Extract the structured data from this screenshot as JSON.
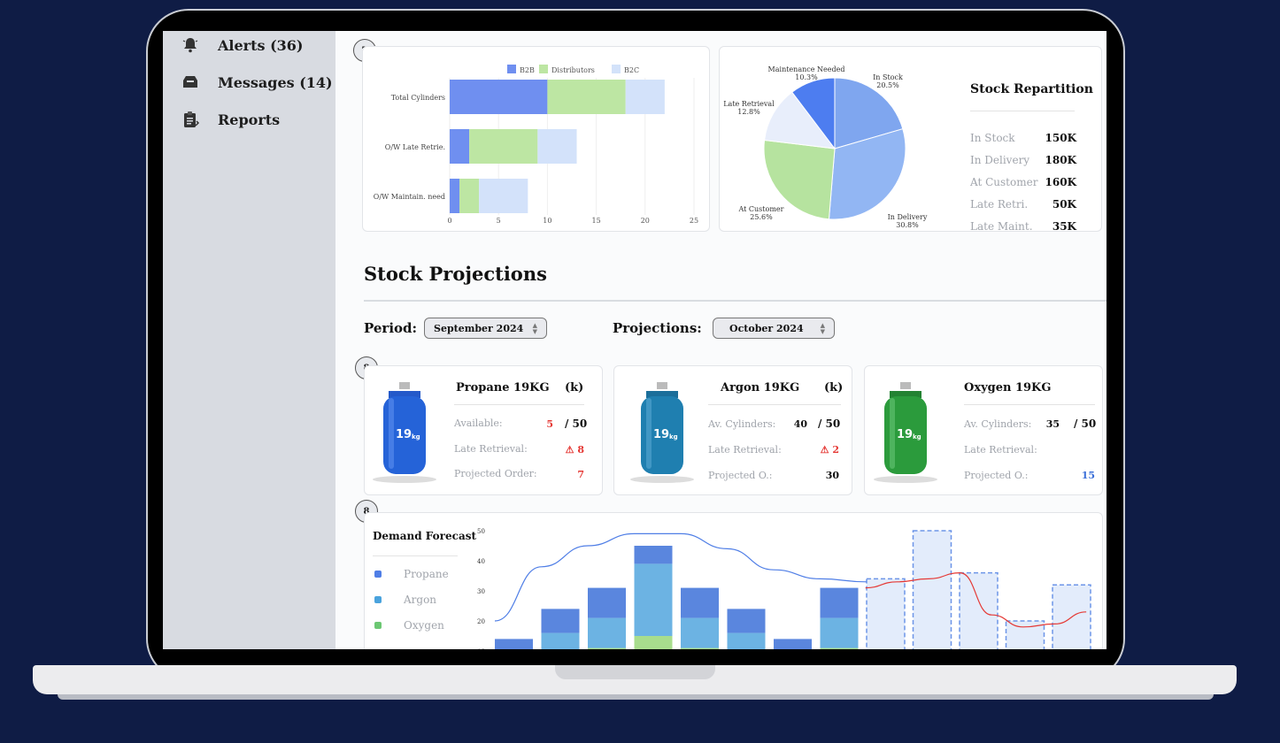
{
  "sidebar": {
    "items": [
      {
        "label": "Alerts (36)",
        "icon": "bell-icon"
      },
      {
        "label": "Messages (14)",
        "icon": "inbox-icon"
      },
      {
        "label": "Reports",
        "icon": "clipboard-icon"
      }
    ]
  },
  "steps": {
    "first": "7",
    "second": "8",
    "third": "8"
  },
  "stock_repartition": {
    "title": "Stock Repartition",
    "rows": [
      {
        "label": "In Stock",
        "value": "150K"
      },
      {
        "label": "In Delivery",
        "value": "180K"
      },
      {
        "label": "At Customer",
        "value": "160K"
      },
      {
        "label": "Late Retri.",
        "value": "50K"
      },
      {
        "label": "Late Maint.",
        "value": "35K"
      }
    ]
  },
  "projections": {
    "title": "Stock Projections",
    "period_label": "Period:",
    "period_value": "September 2024",
    "projections_label": "Projections:",
    "projections_value": "October 2024"
  },
  "products": [
    {
      "name": "Propane 19KG",
      "unit": "(k)",
      "color": "#2563d8",
      "tag": "19",
      "rows": [
        {
          "label": "Available:",
          "value": "5",
          "color": "red",
          "denom": "/ 50"
        },
        {
          "label": "Late Retrieval:",
          "value": "⚠ 8",
          "color": "red",
          "denom": ""
        },
        {
          "label": "Projected Order:",
          "value": "7",
          "color": "red",
          "denom": ""
        }
      ]
    },
    {
      "name": "Argon 19KG",
      "unit": "(k)",
      "color": "#1f7fb0",
      "tag": "19",
      "rows": [
        {
          "label": "Av. Cylinders:",
          "value": "40",
          "color": "black",
          "denom": "/ 50"
        },
        {
          "label": "Late Retrieval:",
          "value": "⚠ 2",
          "color": "red",
          "denom": ""
        },
        {
          "label": "Projected O.:",
          "value": "30",
          "color": "black",
          "denom": ""
        }
      ]
    },
    {
      "name": "Oxygen 19KG",
      "unit": "",
      "color": "#2b9b3c",
      "tag": "19",
      "rows": [
        {
          "label": "Av. Cylinders:",
          "value": "35",
          "color": "black",
          "denom": "/ 50"
        },
        {
          "label": "Late Retrieval:",
          "value": "",
          "color": "black",
          "denom": ""
        },
        {
          "label": "Projected O.:",
          "value": "15",
          "color": "blue",
          "denom": ""
        }
      ]
    }
  ],
  "demand_forecast": {
    "title": "Demand Forecast",
    "legend": [
      {
        "label": "Propane",
        "color": "#4f7ee6"
      },
      {
        "label": "Argon",
        "color": "#4aa3dd"
      },
      {
        "label": "Oxygen",
        "color": "#6cc773"
      }
    ]
  },
  "chart_data": [
    {
      "type": "bar",
      "orientation": "horizontal",
      "stacked": true,
      "categories": [
        "Total Cylinders",
        "O/W Late Retrie.",
        "O/W Maintain. need"
      ],
      "series": [
        {
          "name": "B2B",
          "values": [
            10,
            2,
            1
          ],
          "color": "#6f8ff0"
        },
        {
          "name": "Distributors",
          "values": [
            8,
            7,
            2
          ],
          "color": "#bde6a3"
        },
        {
          "name": "B2C",
          "values": [
            4,
            4,
            5
          ],
          "color": "#d3e2fa"
        }
      ],
      "xlim": [
        0,
        25
      ],
      "xticks": [
        "0",
        "5",
        "10",
        "15",
        "20",
        "25"
      ],
      "legend_position": "top"
    },
    {
      "type": "pie",
      "slices": [
        {
          "label": "In Stock",
          "pct": "20.5%",
          "value": 20.5,
          "color": "#7fa6ef"
        },
        {
          "label": "In Delivery",
          "pct": "30.8%",
          "value": 30.8,
          "color": "#92b6f3"
        },
        {
          "label": "At Customer",
          "pct": "25.6%",
          "value": 25.6,
          "color": "#b6e39f"
        },
        {
          "label": "Late Retrieval",
          "pct": "12.8%",
          "value": 12.8,
          "color": "#e8eefb"
        },
        {
          "label": "Maintenance Needed",
          "pct": "10.3%",
          "value": 10.3,
          "color": "#4d7df0"
        }
      ]
    },
    {
      "type": "bar",
      "stacked": true,
      "ylim": [
        0,
        50
      ],
      "yticks": [
        "10",
        "20",
        "30",
        "40",
        "50"
      ],
      "actual": [
        {
          "oxygen": 2,
          "argon": 8,
          "propane": 4
        },
        {
          "oxygen": 6,
          "argon": 10,
          "propane": 8
        },
        {
          "oxygen": 11,
          "argon": 10,
          "propane": 10
        },
        {
          "oxygen": 15,
          "argon": 24,
          "propane": 6
        },
        {
          "oxygen": 11,
          "argon": 10,
          "propane": 10
        },
        {
          "oxygen": 6,
          "argon": 10,
          "propane": 8
        },
        {
          "oxygen": 2,
          "argon": 8,
          "propane": 4
        },
        {
          "oxygen": 11,
          "argon": 10,
          "propane": 10
        }
      ],
      "projected": [
        34,
        50,
        36,
        20,
        32
      ],
      "trend_actual": [
        20,
        38,
        45,
        49,
        49,
        44,
        37,
        34,
        33
      ],
      "trend_projected": [
        31,
        33,
        34,
        36,
        22,
        18,
        19,
        23
      ]
    }
  ]
}
